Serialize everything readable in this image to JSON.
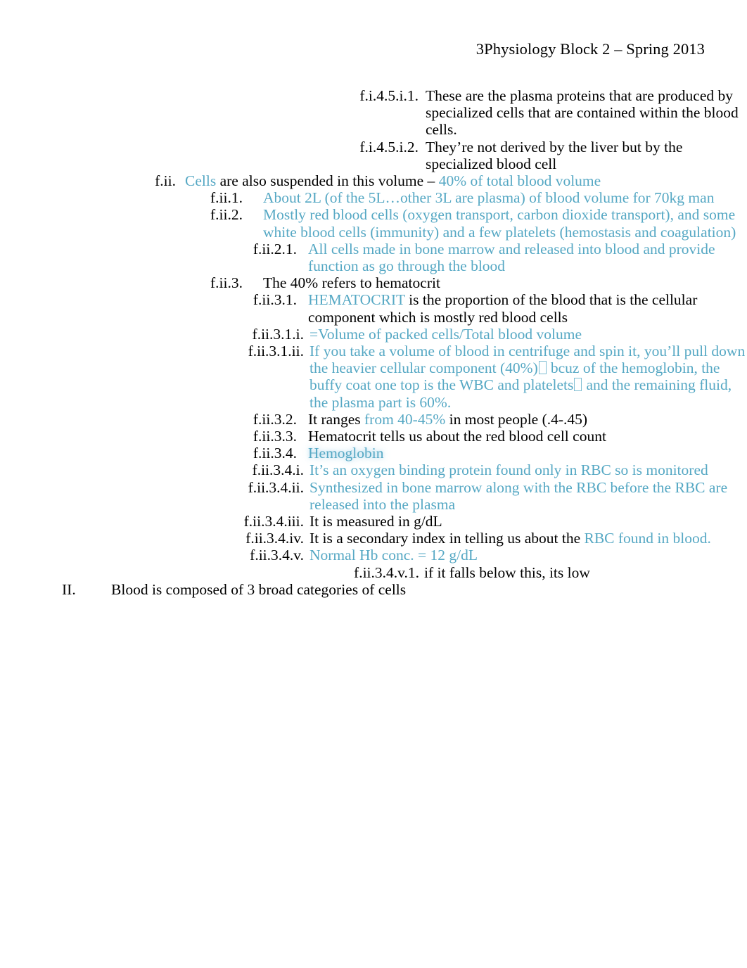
{
  "document": {
    "header": "3Physiology Block 2 – Spring 2013",
    "accent_color": "#56A8C4",
    "text_color": "#000000"
  },
  "outline": [
    {
      "id": "f.i.4.5.i.1",
      "label": "f.i.4.5.i.1.",
      "level": 1,
      "segments": [
        {
          "text": "These are the plasma proteins that are produced by specialized cells that are contained within the blood cells.",
          "color": "black"
        }
      ]
    },
    {
      "id": "f.i.4.5.i.2",
      "label": "f.i.4.5.i.2.",
      "level": 1,
      "segments": [
        {
          "text": "They’re not derived by the liver but by the specialized blood cell",
          "color": "black"
        }
      ]
    },
    {
      "id": "f.ii",
      "label": "f.ii.",
      "level": 2,
      "segments": [
        {
          "text": "Cells",
          "color": "teal"
        },
        {
          "text": " are also suspended in this volume – ",
          "color": "black"
        },
        {
          "text": "40% of total blood volume",
          "color": "teal"
        }
      ]
    },
    {
      "id": "f.ii.1",
      "label": "f.ii.1.",
      "level": 3,
      "segments": [
        {
          "text": "About 2L (of the 5L…other 3L are plasma) of blood volume for 70kg man",
          "color": "teal"
        }
      ]
    },
    {
      "id": "f.ii.2",
      "label": "f.ii.2.",
      "level": 3,
      "segments": [
        {
          "text": "Mostly red blood cells (oxygen transport, carbon dioxide transport), and some white blood cells (immunity) and a few platelets (hemostasis and coagulation)",
          "color": "teal"
        }
      ]
    },
    {
      "id": "f.ii.2.1",
      "label": "f.ii.2.1.",
      "level": 4,
      "segments": [
        {
          "text": "All cells made in bone marrow and released into blood and provide function as go through the blood",
          "color": "teal"
        }
      ]
    },
    {
      "id": "f.ii.3",
      "label": "f.ii.3.",
      "level": 3,
      "segments": [
        {
          "text": "The 40% refers to hematocrit",
          "color": "black"
        }
      ]
    },
    {
      "id": "f.ii.3.1",
      "label": "f.ii.3.1.",
      "level": 4,
      "segments": [
        {
          "text": "HEMATOCRIT",
          "color": "teal"
        },
        {
          "text": "   is the proportion of the blood that is the cellular component which is mostly red blood cells",
          "color": "black"
        }
      ]
    },
    {
      "id": "f.ii.3.1.i",
      "label": "f.ii.3.1.i.",
      "level": 5,
      "segments": [
        {
          "text": "=Volume of packed cells/Total blood volume",
          "color": "teal"
        }
      ]
    },
    {
      "id": "f.ii.3.1.ii",
      "label": "f.ii.3.1.ii.",
      "level": 5,
      "segments": [
        {
          "text": "If you take a volume of blood in centrifuge and spin it, you’ll pull down the heavier cellular component (40%)",
          "color": "teal"
        },
        {
          "glyph": "tofu",
          "color": "teal"
        },
        {
          "text": " bcuz of the hemoglobin, the buffy coat one top is the WBC and platelets",
          "color": "teal"
        },
        {
          "glyph": "tofu",
          "color": "teal"
        },
        {
          "text": " and the remaining fluid, the plasma part is 60%.",
          "color": "teal"
        }
      ]
    },
    {
      "id": "f.ii.3.2",
      "label": "f.ii.3.2.",
      "level": 4,
      "segments": [
        {
          "text": "It ranges ",
          "color": "black"
        },
        {
          "text": "from 40-45%",
          "color": "teal"
        },
        {
          "text": " in most people (.4-.45)",
          "color": "black"
        }
      ]
    },
    {
      "id": "f.ii.3.3",
      "label": "f.ii.3.3.",
      "level": 4,
      "segments": [
        {
          "text": "Hematocrit tells us about the red blood cell count",
          "color": "black"
        }
      ]
    },
    {
      "id": "f.ii.3.4",
      "label": "f.ii.3.4.",
      "level": 4,
      "segments": [
        {
          "text": "Hemoglobin",
          "color": "teal",
          "effect": "glow"
        }
      ]
    },
    {
      "id": "f.ii.3.4.i",
      "label": "f.ii.3.4.i.",
      "level": 5,
      "segments": [
        {
          "text": "It’s an oxygen binding protein found only in RBC so is monitored",
          "color": "teal"
        }
      ]
    },
    {
      "id": "f.ii.3.4.ii",
      "label": "f.ii.3.4.ii.",
      "level": 5,
      "segments": [
        {
          "text": "Synthesized in bone marrow along with the RBC before the RBC are released into the plasma",
          "color": "teal"
        }
      ]
    },
    {
      "id": "f.ii.3.4.iii",
      "label": "f.ii.3.4.iii.",
      "level": 5,
      "segments": [
        {
          "text": "It is measured in g/dL",
          "color": "black"
        }
      ]
    },
    {
      "id": "f.ii.3.4.iv",
      "label": "f.ii.3.4.iv.",
      "level": 5,
      "segments": [
        {
          "text": "It is a secondary index in telling us about the ",
          "color": "black"
        },
        {
          "text": "RBC found in blood.",
          "color": "teal"
        }
      ]
    },
    {
      "id": "f.ii.3.4.v",
      "label": "f.ii.3.4.v.",
      "level": 5,
      "segments": [
        {
          "text": "Normal Hb conc. = 12 g/dL",
          "color": "teal"
        }
      ]
    },
    {
      "id": "f.ii.3.4.v.1",
      "label": "f.ii.3.4.v.1.",
      "level": 6,
      "segments": [
        {
          "text": "if it falls below this, its low",
          "color": "black"
        }
      ]
    },
    {
      "id": "II",
      "label": "II.",
      "level": 0,
      "segments": [
        {
          "text": "Blood is composed of 3 broad categories of cells",
          "color": "black"
        }
      ]
    }
  ]
}
